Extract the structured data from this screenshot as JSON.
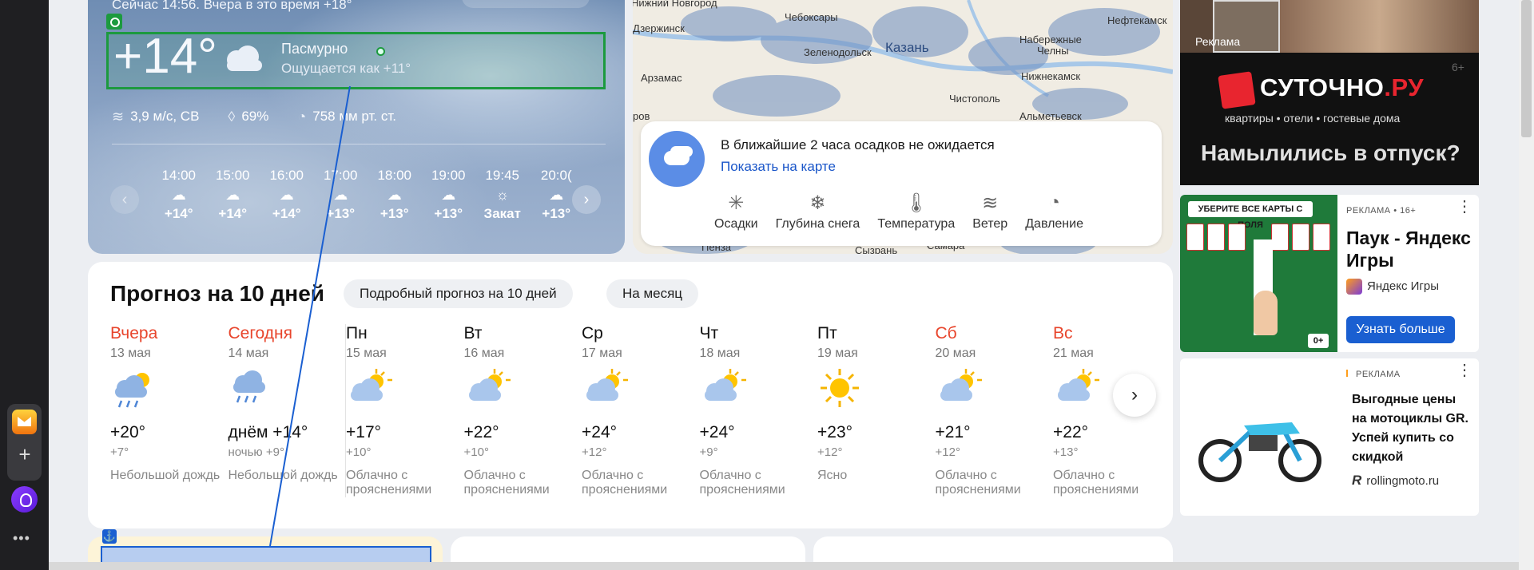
{
  "now": {
    "line": "Сейчас 14:56. Вчера в это время +18°",
    "temp": "+14°",
    "condition": "Пасмурно",
    "feels": "Ощущается как +11°",
    "wind": "3,9 м/с, СВ",
    "humidity": "69%",
    "pressure": "758 мм рт. ст."
  },
  "hourly": [
    {
      "time": "14:00",
      "temp": "+14°",
      "icon": "cloud-sun"
    },
    {
      "time": "15:00",
      "temp": "+14°",
      "icon": "cloud-sun"
    },
    {
      "time": "16:00",
      "temp": "+14°",
      "icon": "cloud-sun"
    },
    {
      "time": "17:00",
      "temp": "+13°",
      "icon": "cloud-sun"
    },
    {
      "time": "18:00",
      "temp": "+13°",
      "icon": "cloud-sun"
    },
    {
      "time": "19:00",
      "temp": "+13°",
      "icon": "cloud-sun"
    },
    {
      "time": "19:45",
      "temp": "Закат",
      "icon": "sunset"
    },
    {
      "time": "20:0(",
      "temp": "+13°",
      "icon": "cloud-sun"
    }
  ],
  "map": {
    "cities": [
      {
        "name": "Нижний Новгород"
      },
      {
        "name": "Чебоксары"
      },
      {
        "name": "Нефтекамск"
      },
      {
        "name": "Набережные"
      },
      {
        "name": "Челны"
      },
      {
        "name": "Казань"
      },
      {
        "name": "Зеленодольск"
      },
      {
        "name": "Арзамас"
      },
      {
        "name": "Нижнекамск"
      },
      {
        "name": "Чистополь"
      },
      {
        "name": "Альметьевск"
      },
      {
        "name": "Пенза"
      },
      {
        "name": "Сызрань"
      },
      {
        "name": "Самара"
      },
      {
        "name": "Дзержинск"
      },
      {
        "name": "ров"
      }
    ],
    "precip_text": "В ближайшие 2 часа осадков не ожидается",
    "precip_link": "Показать на карте",
    "tabs": [
      {
        "label": "Осадки",
        "icon": "precipitation-icon"
      },
      {
        "label": "Глубина снега",
        "icon": "snowflake-icon"
      },
      {
        "label": "Температура",
        "icon": "thermometer-icon"
      },
      {
        "label": "Ветер",
        "icon": "wind-icon"
      },
      {
        "label": "Давление",
        "icon": "pressure-icon"
      }
    ]
  },
  "forecast": {
    "title": "Прогноз на 10 дней",
    "detail_btn": "Подробный прогноз на 10 дней",
    "month_btn": "На месяц",
    "days": [
      {
        "name": "Вчера",
        "date": "13 мая",
        "hi": "+20°",
        "lo": "+7°",
        "cond": "Небольшой дождь",
        "icon": "rain-sun",
        "weekend": true
      },
      {
        "name": "Сегодня",
        "date": "14 мая",
        "hi": "днём +14°",
        "lo": "ночью +9°",
        "cond": "Небольшой дождь",
        "icon": "rain",
        "weekend": true
      },
      {
        "name": "Пн",
        "date": "15 мая",
        "hi": "+17°",
        "lo": "+10°",
        "cond": "Облачно с прояснениями",
        "icon": "cloud-sun",
        "weekend": false
      },
      {
        "name": "Вт",
        "date": "16 мая",
        "hi": "+22°",
        "lo": "+10°",
        "cond": "Облачно с прояснениями",
        "icon": "cloud-sun",
        "weekend": false
      },
      {
        "name": "Ср",
        "date": "17 мая",
        "hi": "+24°",
        "lo": "+12°",
        "cond": "Облачно с прояснениями",
        "icon": "cloud-sun",
        "weekend": false
      },
      {
        "name": "Чт",
        "date": "18 мая",
        "hi": "+24°",
        "lo": "+9°",
        "cond": "Облачно с прояснениями",
        "icon": "cloud-sun",
        "weekend": false
      },
      {
        "name": "Пт",
        "date": "19 мая",
        "hi": "+23°",
        "lo": "+12°",
        "cond": "Ясно",
        "icon": "sun",
        "weekend": false
      },
      {
        "name": "Сб",
        "date": "20 мая",
        "hi": "+21°",
        "lo": "+12°",
        "cond": "Облачно с прояснениями",
        "icon": "cloud-sun",
        "weekend": true
      },
      {
        "name": "Вс",
        "date": "21 мая",
        "hi": "+22°",
        "lo": "+13°",
        "cond": "Облачно с прояснениями",
        "icon": "cloud-sun",
        "weekend": true
      }
    ]
  },
  "ads": {
    "ad1": {
      "reklama": "Реклама",
      "brand_main": "СУТОЧНО",
      "brand_ru": ".РУ",
      "tagline": "квартиры • отели • гостевые дома",
      "age": "6+",
      "slogan": "Намылились в отпуск?"
    },
    "ad2": {
      "banner": "УБЕРИТЕ ВСЕ КАРТЫ С ПОЛЯ",
      "age": "0+",
      "label": "РЕКЛАМА • 16+",
      "title": "Паук - Яндекс Игры",
      "source": "Яндекс Игры",
      "button": "Узнать больше"
    },
    "ad3": {
      "label": "РЕКЛАМА",
      "title": "Выгодные цены на мотоциклы GR. Успей купить со скидкой",
      "source_logo": "R",
      "source": "rollingmoto.ru"
    }
  },
  "colors": {
    "accent_green": "#1c9a3e",
    "link_blue": "#1a56c9",
    "weekend_red": "#e8452c",
    "button_blue": "#1a5fd1"
  }
}
